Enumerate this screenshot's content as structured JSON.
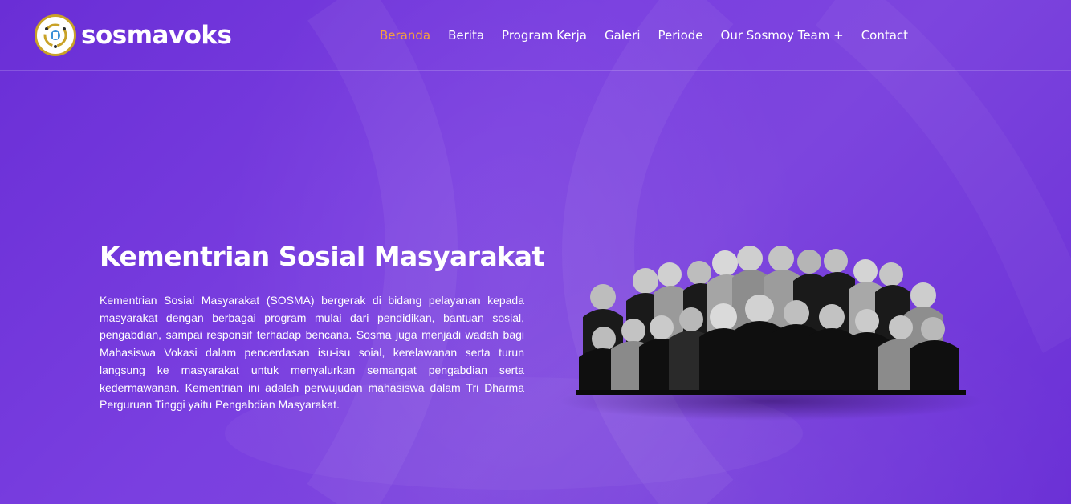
{
  "brand": {
    "name": "sosmavoks"
  },
  "nav": {
    "items": [
      {
        "label": "Beranda",
        "active": true
      },
      {
        "label": "Berita",
        "active": false
      },
      {
        "label": "Program Kerja",
        "active": false
      },
      {
        "label": "Galeri",
        "active": false
      },
      {
        "label": "Periode",
        "active": false
      },
      {
        "label": "Our Sosmoy Team +",
        "active": false
      },
      {
        "label": "Contact",
        "active": false
      }
    ]
  },
  "hero": {
    "title": "Kementrian Sosial Masyarakat",
    "description": "Kementrian Sosial Masyarakat (SOSMA) bergerak di bidang pelayanan kepada masyarakat dengan berbagai program mulai dari pendidikan, bantuan sosial, pengabdian, sampai responsif terhadap bencana. Sosma juga menjadi wadah bagi Mahasiswa Vokasi dalam pencerdasan isu-isu soial, kerelawanan serta turun langsung ke masyarakat untuk menyalurkan semangat pengabdian serta kedermawanan. Kementrian ini adalah perwujudan mahasiswa dalam Tri Dharma Perguruan Tinggi yaitu Pengabdian Masyarakat."
  },
  "colors": {
    "background": "#7b3fe0",
    "accent_active_nav": "#f7a13a",
    "logo_ring": "#c9a227",
    "text": "#ffffff"
  },
  "icons": {
    "logo": "organization-emblem-icon",
    "group_photo": "team-group-photo"
  }
}
